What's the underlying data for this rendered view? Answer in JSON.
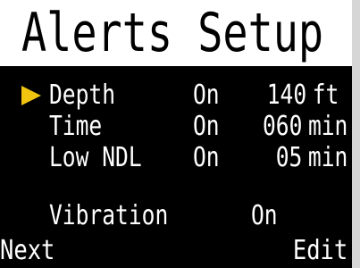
{
  "screen": {
    "title": "Alerts Setup"
  },
  "alerts": [
    {
      "label": "Depth",
      "state": "On",
      "value": "140",
      "unit": "ft",
      "selected": true
    },
    {
      "label": "Time",
      "state": "On",
      "value": "060",
      "unit": "min",
      "selected": false
    },
    {
      "label": "Low NDL",
      "state": "On",
      "value": "05",
      "unit": "min",
      "selected": false
    }
  ],
  "vibration": {
    "label": "Vibration",
    "state": "On"
  },
  "softkeys": {
    "left": "Next",
    "right": "Edit"
  },
  "colors": {
    "background": "#000000",
    "title_bar": "#ffffff",
    "text": "#ffffff",
    "selection_pointer": "#f1c40f"
  },
  "icons": {
    "selection_pointer": "triangle-right-icon"
  }
}
